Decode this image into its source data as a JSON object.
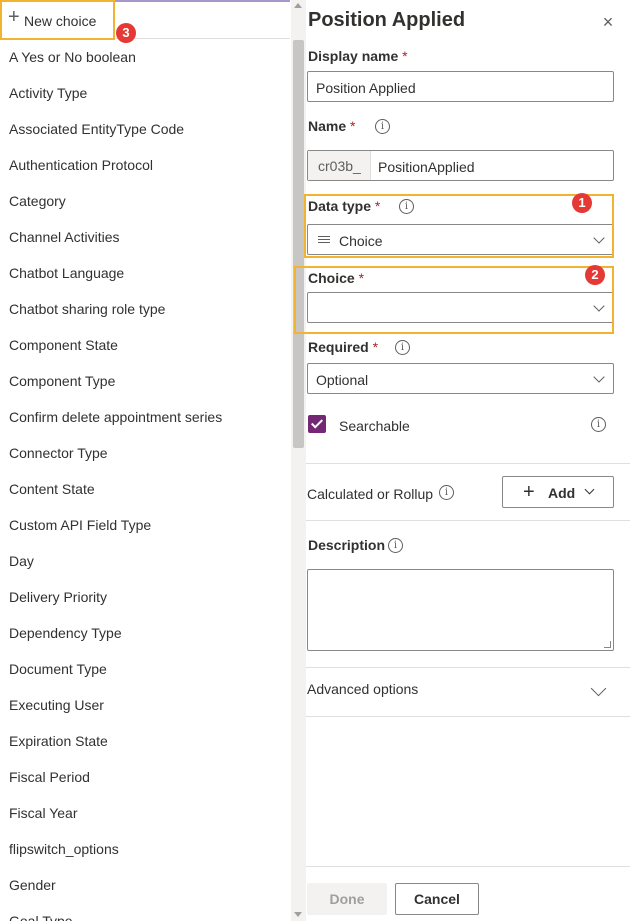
{
  "left_list": {
    "new_choice_label": "New choice",
    "items": [
      "A Yes or No boolean",
      "Activity Type",
      "Associated EntityType Code",
      "Authentication Protocol",
      "Category",
      "Channel Activities",
      "Chatbot Language",
      "Chatbot sharing role type",
      "Component State",
      "Component Type",
      "Confirm delete appointment series",
      "Connector Type",
      "Content State",
      "Custom API Field Type",
      "Day",
      "Delivery Priority",
      "Dependency Type",
      "Document Type",
      "Executing User",
      "Expiration State",
      "Fiscal Period",
      "Fiscal Year",
      "flipswitch_options",
      "Gender",
      "Goal Type"
    ]
  },
  "badges": {
    "one": "1",
    "two": "2",
    "three": "3"
  },
  "panel": {
    "title": "Position Applied",
    "close_icon": "×",
    "display_name": {
      "label": "Display name",
      "required_mark": "*",
      "value": "Position Applied"
    },
    "name": {
      "label": "Name",
      "required_mark": "*",
      "prefix": "cr03b_",
      "value": "PositionApplied"
    },
    "data_type": {
      "label": "Data type",
      "required_mark": "*",
      "value": "Choice"
    },
    "choice": {
      "label": "Choice",
      "required_mark": "*",
      "value": ""
    },
    "required": {
      "label": "Required",
      "required_mark": "*",
      "value": "Optional"
    },
    "searchable": {
      "label": "Searchable"
    },
    "calculated": {
      "label": "Calculated or Rollup",
      "add_label": "Add"
    },
    "description": {
      "label": "Description",
      "value": ""
    },
    "advanced": {
      "label": "Advanced options"
    },
    "done_label": "Done",
    "cancel_label": "Cancel",
    "info_glyph": "i"
  },
  "colors": {
    "accent": "#742774",
    "highlight": "#f2b32e",
    "badge": "#e53935"
  }
}
